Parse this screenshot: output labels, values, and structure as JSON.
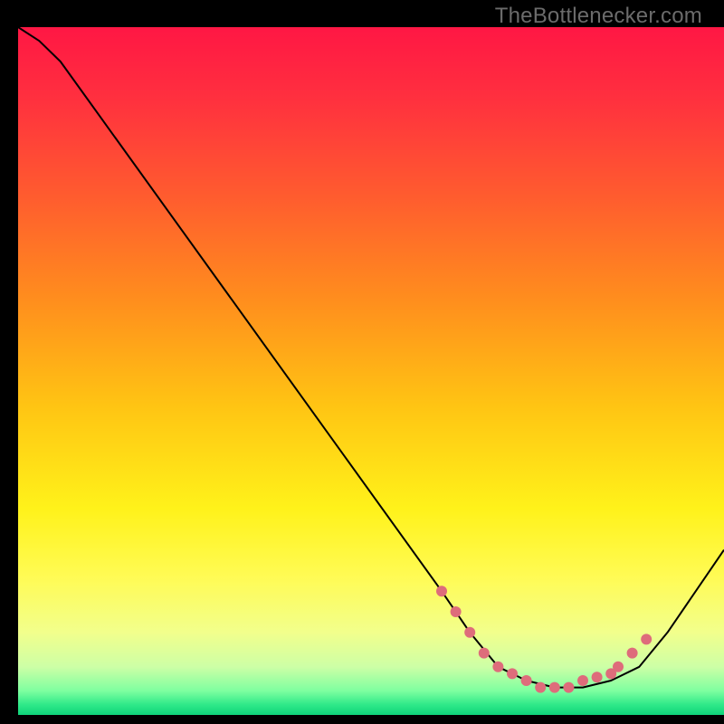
{
  "watermark": "TheBottlenecker.com",
  "chart_data": {
    "type": "line",
    "title": "",
    "xlabel": "",
    "ylabel": "",
    "xlim": [
      0,
      100
    ],
    "ylim": [
      0,
      100
    ],
    "background_gradient": {
      "stops": [
        {
          "offset": 0.0,
          "color": "#ff1744"
        },
        {
          "offset": 0.1,
          "color": "#ff2f3f"
        },
        {
          "offset": 0.25,
          "color": "#ff5d2e"
        },
        {
          "offset": 0.4,
          "color": "#ff8f1d"
        },
        {
          "offset": 0.55,
          "color": "#ffc413"
        },
        {
          "offset": 0.7,
          "color": "#fff21a"
        },
        {
          "offset": 0.8,
          "color": "#fffb55"
        },
        {
          "offset": 0.88,
          "color": "#f2ff8c"
        },
        {
          "offset": 0.93,
          "color": "#cdffa6"
        },
        {
          "offset": 0.965,
          "color": "#7effa0"
        },
        {
          "offset": 0.985,
          "color": "#2fe989"
        },
        {
          "offset": 1.0,
          "color": "#0fd37a"
        }
      ]
    },
    "series": [
      {
        "name": "bottleneck-curve",
        "color": "#000000",
        "x": [
          0,
          3,
          6,
          60,
          64,
          68,
          72,
          76,
          80,
          84,
          88,
          92,
          100
        ],
        "values": [
          100,
          98,
          95,
          18,
          12,
          7,
          5,
          4,
          4,
          5,
          7,
          12,
          24
        ]
      }
    ],
    "markers": {
      "name": "highlighted-range",
      "color": "#de6c7b",
      "radius": 6,
      "x": [
        60,
        62,
        64,
        66,
        68,
        70,
        72,
        74,
        76,
        78,
        80,
        82,
        84,
        85,
        87,
        89
      ],
      "values": [
        18,
        15,
        12,
        9,
        7,
        6,
        5,
        4,
        4,
        4,
        5,
        5.5,
        6,
        7,
        9,
        11
      ]
    }
  }
}
